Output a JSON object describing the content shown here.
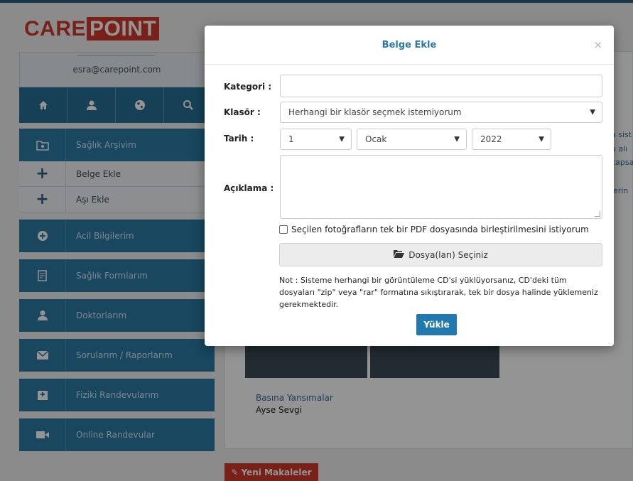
{
  "brand": {
    "logo_left": "CARE",
    "logo_right": "POINT"
  },
  "sidebar": {
    "email": "esra@carepoint.com",
    "iconbar": [
      "home-icon",
      "user-icon",
      "globe-icon",
      "search-icon"
    ],
    "items": [
      {
        "label": "Sağlık Arşivim",
        "icon": "folder-icon",
        "type": "main"
      },
      {
        "label": "Belge Ekle",
        "icon": "plus-icon",
        "type": "sub"
      },
      {
        "label": "Aşı Ekle",
        "icon": "plus-icon",
        "type": "sub"
      },
      {
        "label": "Acil Bilgilerim",
        "icon": "plus-circle-icon",
        "type": "main"
      },
      {
        "label": "Sağlık Formlarım",
        "icon": "form-icon",
        "type": "main"
      },
      {
        "label": "Doktorlarım",
        "icon": "doctor-icon",
        "type": "main"
      },
      {
        "label": "Sorularım / Raporlarım",
        "icon": "envelope-icon",
        "type": "main"
      },
      {
        "label": "Fiziki Randevularım",
        "icon": "hospital-icon",
        "type": "main"
      },
      {
        "label": "Online Randevular",
        "icon": "video-icon",
        "type": "main"
      }
    ]
  },
  "background": {
    "partial_texts": [
      "a sist",
      "u alı",
      "kapsa",
      "lerin"
    ],
    "press_title": "Basına Yansımalar",
    "press_author": "Ayse Sevgi",
    "new_articles": "Yeni Makaleler"
  },
  "modal": {
    "title": "Belge Ekle",
    "close": "×",
    "labels": {
      "category": "Kategori :",
      "folder": "Klasör :",
      "date": "Tarih :",
      "description": "Açıklama :"
    },
    "category_value": "",
    "folder_selected": "Herhangi bir klasör seçmek istemiyorum",
    "date": {
      "day": "1",
      "month": "Ocak",
      "year": "2022"
    },
    "description_value": "",
    "pdf_checkbox_label": "Seçilen fotoğrafların tek bir PDF dosyasında birleştirilmesini istiyorum",
    "pdf_checked": false,
    "file_button": "Dosya(ları) Seçiniz",
    "note": "Not : Sisteme herhangi bir görüntüleme CD'si yüklüyorsanız, CD'deki tüm dosyaları \"zip\" veya \"rar\" formatına sıkıştırarak, tek bir dosya halinde yüklemeniz gerekmektedir.",
    "upload_button": "Yükle"
  },
  "colors": {
    "brand_red": "#d1392b",
    "sidebar_blue": "#2a7aa4",
    "primary_button": "#2279ad",
    "title_blue": "#2b78ad"
  }
}
